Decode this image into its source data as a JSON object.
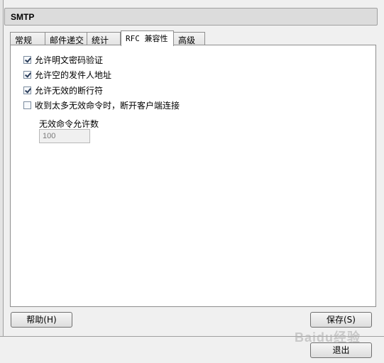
{
  "window": {
    "title": "SMTP"
  },
  "tabs": [
    {
      "label": "常规"
    },
    {
      "label": "邮件递交"
    },
    {
      "label": "统计"
    },
    {
      "label": "RFC 兼容性",
      "active": true
    },
    {
      "label": "高级"
    }
  ],
  "options": [
    {
      "label": "允许明文密码验证",
      "checked": true
    },
    {
      "label": "允许空的发件人地址",
      "checked": true
    },
    {
      "label": "允许无效的断行符",
      "checked": true
    },
    {
      "label": "收到太多无效命令时，断开客户端连接",
      "checked": false
    }
  ],
  "invalid_commands": {
    "label": "无效命令允许数",
    "value": "100"
  },
  "buttons": {
    "help": "帮助(H)",
    "save": "保存(S)",
    "exit": "退出"
  },
  "watermark": {
    "text": "Baidu经验"
  }
}
